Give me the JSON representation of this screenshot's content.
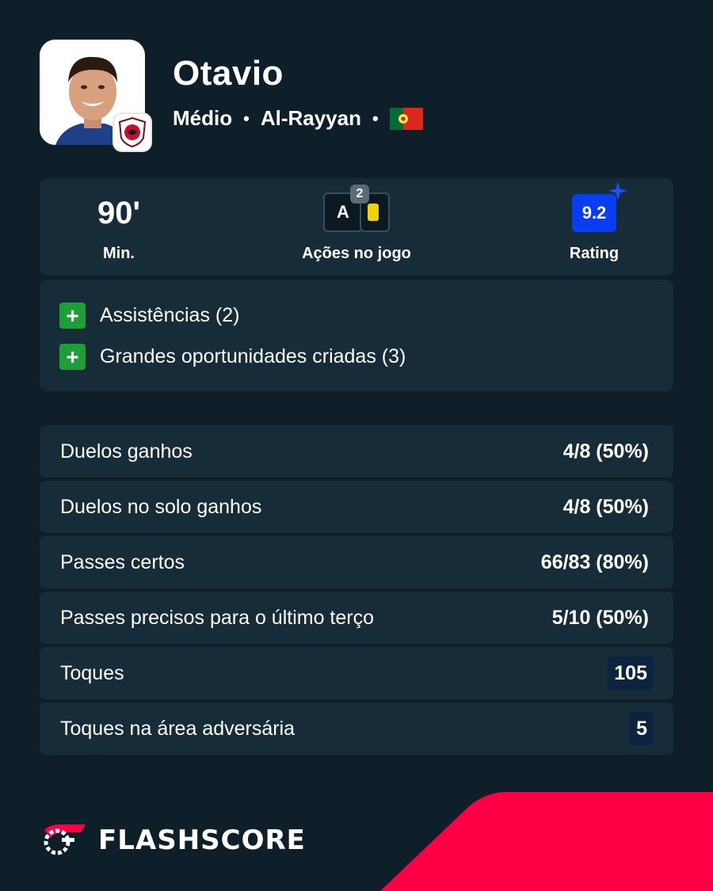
{
  "player": {
    "name": "Otavio",
    "position": "Médio",
    "club": "Al-Rayyan",
    "flag_icon": "portugal-flag-icon"
  },
  "summary": {
    "minutes_value": "90'",
    "minutes_label": "Min.",
    "actions_letter": "A",
    "actions_count": "2",
    "actions_label": "Ações no jogo",
    "rating_value": "9.2",
    "rating_label": "Rating"
  },
  "actions": [
    {
      "icon": "plus-icon",
      "text": "Assistências (2)"
    },
    {
      "icon": "plus-icon",
      "text": "Grandes oportunidades criadas (3)"
    }
  ],
  "stats": [
    {
      "label": "Duelos ganhos",
      "value": "4/8 (50%)"
    },
    {
      "label": "Duelos no solo ganhos",
      "value": "4/8 (50%)"
    },
    {
      "label": "Passes certos",
      "value": "66/83 (80%)"
    },
    {
      "label": "Passes precisos para o último terço",
      "value": "5/10 (50%)"
    },
    {
      "label": "Toques",
      "value": "105"
    },
    {
      "label": "Toques na área adversária",
      "value": "5"
    }
  ],
  "brand": {
    "name": "FLASHSCORE"
  },
  "colors": {
    "background": "#0e1f2a",
    "card": "#162d39",
    "accent_red": "#ff0046",
    "rating_blue": "#0a3cf0",
    "positive_green": "#1d9e37",
    "yellow_card": "#f5d100"
  }
}
